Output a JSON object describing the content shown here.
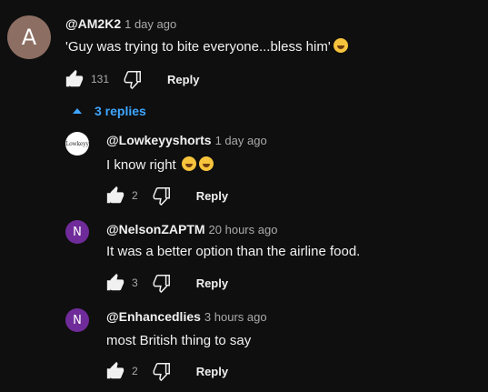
{
  "top_comment": {
    "avatar_letter": "A",
    "author": "@AM2K2",
    "time": "1 day ago",
    "text": "'Guy was trying to bite everyone...bless him'",
    "emoji": "rolling-on-floor-laughing",
    "likes": "131",
    "reply_label": "Reply"
  },
  "replies_toggle": {
    "label": "3 replies"
  },
  "replies": [
    {
      "avatar_text": "Lowkeyy",
      "author": "@Lowkeyyshorts",
      "time": "1 day ago",
      "text": "I know right",
      "emoji": "face-with-tears-of-joy x2",
      "likes": "2",
      "reply_label": "Reply"
    },
    {
      "avatar_letter": "N",
      "author": "@NelsonZAPTM",
      "time": "20 hours ago",
      "text": "It was a better option than the airline food.",
      "likes": "3",
      "reply_label": "Reply"
    },
    {
      "avatar_letter": "N",
      "author": "@Enhancedlies",
      "time": "3 hours ago",
      "text": "most British thing to say",
      "likes": "2",
      "reply_label": "Reply"
    }
  ],
  "colors": {
    "background": "#0f0f0f",
    "link_blue": "#3ea6ff",
    "avatar_brown": "#8d6e63",
    "avatar_purple": "#6f2b9a"
  }
}
